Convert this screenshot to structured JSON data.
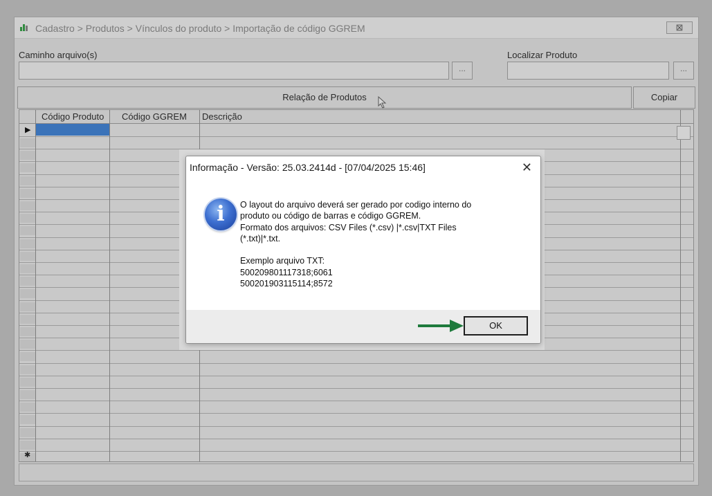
{
  "window": {
    "title": "Cadastro > Produtos > Vínculos do produto > Importação de código GGREM",
    "close_glyph": "⊠",
    "icon": "app-icon"
  },
  "form": {
    "path_label": "Caminho arquivo(s)",
    "path_value": "",
    "browse_glyph": "...",
    "find_label": "Localizar Produto",
    "find_value": "",
    "find_glyph": "...",
    "relation_button": "Relação de Produtos",
    "copy_button": "Copiar"
  },
  "grid": {
    "columns": [
      "Código Produto",
      "Código GGREM",
      "Descrição"
    ],
    "current_row_marker": "▶",
    "new_row_marker": "✱",
    "rows": []
  },
  "dialog": {
    "title": "Informação - Versão: 25.03.2414d - [07/04/2025 15:46]",
    "close_glyph": "✕",
    "icon": "information-icon",
    "icon_glyph": "i",
    "message_lines": [
      " O layout do arquivo deverá ser gerado por codigo interno do",
      "produto ou código de barras e código GGREM.",
      "Formato dos arquivos: CSV Files (*.csv) |*.csv|TXT Files",
      "(*.txt)|*.txt.",
      "",
      "Exemplo arquivo TXT:",
      "500209801117318;6061",
      "500201903115114;8572"
    ],
    "ok_button": "OK"
  },
  "annotation": {
    "arrow_color": "#1e7a3c"
  }
}
